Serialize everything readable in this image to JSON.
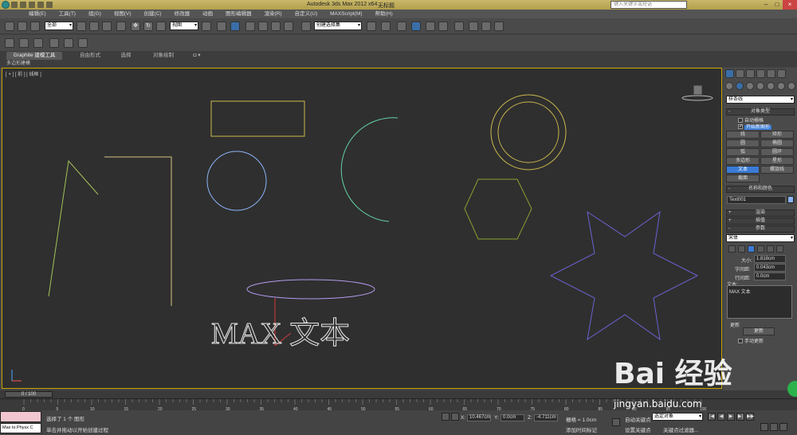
{
  "titlebar": {
    "app_title": "Autodesk 3ds Max  2012 x64",
    "doc_name": "无标题",
    "search_placeholder": "键入关键字或短语"
  },
  "menu": [
    "编辑(E)",
    "工具(T)",
    "组(G)",
    "视图(V)",
    "创建(C)",
    "修改器",
    "动画",
    "图形编辑器",
    "渲染(R)",
    "自定义(U)",
    "MAXScript(M)",
    "帮助(H)"
  ],
  "toolbar": {
    "filter_value": "全部",
    "refcoord_value": "视图",
    "named_selection": "创建选择集"
  },
  "ribbon": {
    "tabs": [
      "Graphite 建模工具",
      "自由形式",
      "选择",
      "对象绘制"
    ],
    "sub_label": "多边形建模"
  },
  "viewport": {
    "label": "[ + ] [ 前 ] [ 线框 ]",
    "text_object": "MAX 文本"
  },
  "command_panel": {
    "category": "样条线",
    "object_type_title": "对象类型",
    "auto_grid": "自动栅格",
    "start_new_shape": "开始新图形",
    "buttons": [
      "线",
      "矩形",
      "圆",
      "椭圆",
      "弧",
      "圆环",
      "多边形",
      "星形",
      "文本",
      "螺旋线",
      "截面"
    ],
    "name_color_title": "名称和颜色",
    "object_name": "Text001",
    "render_title": "渲染",
    "interp_title": "插值",
    "params_title": "参数",
    "font": "宋体",
    "size_label": "大小:",
    "size_value": "1.818cm",
    "kerning_label": "字间距:",
    "kerning_value": "0.043cm",
    "leading_label": "行间距:",
    "leading_value": "0.0cm",
    "text_label": "文本:",
    "text_value": "MAX 文本",
    "update_title": "更新",
    "update_button": "更新",
    "manual_update": "手动更新"
  },
  "timeline": {
    "position": "0 / 100",
    "ticks": [
      "0",
      "5",
      "10",
      "15",
      "20",
      "25",
      "30",
      "35",
      "40",
      "45",
      "50",
      "55",
      "60",
      "65",
      "70",
      "75",
      "80",
      "85",
      "90",
      "95",
      "100"
    ]
  },
  "status": {
    "maxscript_text": "Max to Physx C",
    "selected": "选择了 1 个 图形",
    "prompt": "单击并拖动以开始创建过程",
    "x_label": "X:",
    "x_value": "10.467cm",
    "y_label": "Y:",
    "y_value": "0.0cm",
    "z_label": "Z:",
    "z_value": "-4.711cm",
    "grid": "栅格 = 1.0cm",
    "add_time_tag": "添加时间标记",
    "auto_key": "自动关键点",
    "selected_object": "选定对象",
    "set_key": "设置关键点",
    "key_filters": "关键点过滤器..."
  },
  "watermark": {
    "brand": "Bai 经验",
    "url": "jingyan.baidu.com"
  },
  "colors": {
    "viewport_border": "#c8a200",
    "active_button": "#3a7bd5"
  }
}
